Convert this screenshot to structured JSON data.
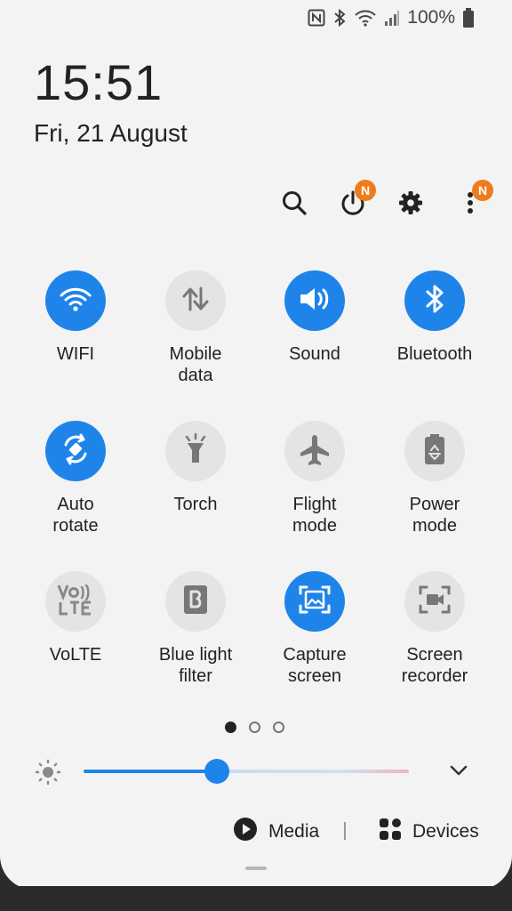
{
  "status_bar": {
    "battery_text": "100%",
    "icons": [
      "nfc-icon",
      "bluetooth-icon",
      "wifi-icon",
      "signal-icon",
      "battery-icon"
    ]
  },
  "clock": {
    "time": "15:51",
    "date": "Fri, 21 August"
  },
  "actions": {
    "search_icon": "search-icon",
    "power_icon": "power-icon",
    "power_badge": "N",
    "settings_icon": "gear-icon",
    "more_icon": "more-vert-icon",
    "more_badge": "N"
  },
  "tiles": [
    {
      "label": "WIFI",
      "on": true,
      "icon": "wifi-icon"
    },
    {
      "label": "Mobile\ndata",
      "on": false,
      "icon": "mobile-data-icon"
    },
    {
      "label": "Sound",
      "on": true,
      "icon": "sound-icon"
    },
    {
      "label": "Bluetooth",
      "on": true,
      "icon": "bluetooth-icon"
    },
    {
      "label": "Auto\nrotate",
      "on": true,
      "icon": "auto-rotate-icon"
    },
    {
      "label": "Torch",
      "on": false,
      "icon": "torch-icon"
    },
    {
      "label": "Flight\nmode",
      "on": false,
      "icon": "airplane-icon"
    },
    {
      "label": "Power\nmode",
      "on": false,
      "icon": "power-mode-icon"
    },
    {
      "label": "VoLTE",
      "on": false,
      "icon": "volte-icon"
    },
    {
      "label": "Blue light\nfilter",
      "on": false,
      "icon": "blue-light-icon"
    },
    {
      "label": "Capture\nscreen",
      "on": true,
      "icon": "capture-screen-icon"
    },
    {
      "label": "Screen\nrecorder",
      "on": false,
      "icon": "screen-recorder-icon"
    }
  ],
  "pager": {
    "pages": 3,
    "active": 0
  },
  "brightness": {
    "level": 0.41,
    "expand_icon": "chevron-down-icon"
  },
  "bottom": {
    "media_label": "Media",
    "devices_label": "Devices"
  },
  "colors": {
    "accent": "#1f84ea",
    "badge": "#f07b1d",
    "tile_off": "#e4e4e4",
    "panel": "#f3f3f3"
  }
}
